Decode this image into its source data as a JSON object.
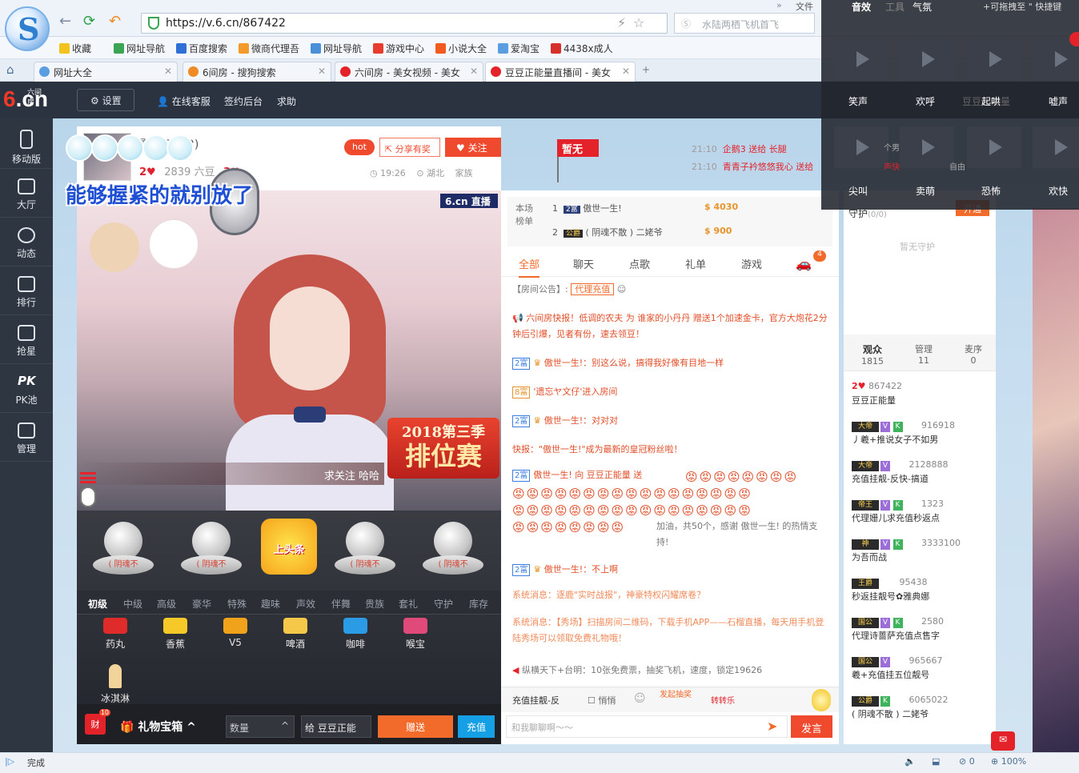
{
  "browser": {
    "url": "https://v.6.cn/867422",
    "search_placeholder": "水陆两栖飞机首飞",
    "menu_more": "文件",
    "bookmarks": [
      "收藏",
      "网址导航",
      "百度搜索",
      "微商代理吾",
      "网址导航",
      "游戏中心",
      "小说大全",
      "爱淘宝",
      "4438x成人"
    ],
    "tabs": [
      {
        "label": "网址大全"
      },
      {
        "label": "6间房 - 搜狗搜索"
      },
      {
        "label": "六间房 - 美女视频 - 美女"
      },
      {
        "label": "豆豆正能量直播间 - 美女"
      }
    ],
    "status": "完成",
    "zoom": "100%",
    "status_count": "0"
  },
  "site": {
    "logo_sub": "六间房",
    "logo_main": ".cn",
    "settings_label": "设置",
    "header_links": [
      "在线客服",
      "签约后台",
      "求助"
    ]
  },
  "leftnav": [
    {
      "label": "移动版",
      "icon": "phone-icon"
    },
    {
      "label": "大厅",
      "icon": "tv-icon"
    },
    {
      "label": "动态",
      "icon": "compass-icon"
    },
    {
      "label": "排行",
      "icon": "crown-icon"
    },
    {
      "label": "抢星",
      "icon": "star-bag-icon"
    },
    {
      "label": "PK池",
      "icon": "pk-icon"
    },
    {
      "label": "管理",
      "icon": "users-icon"
    }
  ],
  "room": {
    "host_name": "量(867422)",
    "hearts_left": "2",
    "six_beans": "2839 六豆",
    "hearts_right": "3",
    "hot": "hot",
    "share": "分享有奖",
    "follow": "关注",
    "time": "19:26",
    "location": "湖北",
    "family": "家族",
    "overlay_text": "能够握紧的就别放了",
    "video_badge": "6.cn 直播",
    "season_year": "2018第三季",
    "season_title": "排位赛",
    "strip_text": "求关注  哈哈"
  },
  "banner": {
    "flag": "暂无",
    "notices": [
      {
        "time": "21:10",
        "text": "企鹅3 送给 长腿"
      },
      {
        "time": "21:10",
        "text": "青青子衿悠悠我心 送给"
      }
    ]
  },
  "gift": {
    "slots": [
      "( 阴魂不",
      "( 阴魂不",
      "上头条",
      "( 阴魂不",
      "( 阴魂不"
    ],
    "tabs": [
      "初级",
      "中级",
      "高级",
      "豪华",
      "特殊",
      "趣味",
      "声效",
      "伴舞",
      "贵族",
      "套礼",
      "守护",
      "库存"
    ],
    "items": [
      {
        "label": "药丸",
        "color": "#e02b2b"
      },
      {
        "label": "香蕉",
        "color": "#f6c928"
      },
      {
        "label": "V5",
        "color": "#f0a21b"
      },
      {
        "label": "啤酒",
        "color": "#f5c84a"
      },
      {
        "label": "咖啡",
        "color": "#2c9be6"
      },
      {
        "label": "喉宝",
        "color": "#e04a7a"
      },
      {
        "label": "冰淇淋",
        "color": "#f2d39a"
      }
    ],
    "cai_badge": "10",
    "cai_label": "财",
    "box_label": "礼物宝箱",
    "qty_label": "数量",
    "to_label": "给 豆豆正能",
    "send": "赠送",
    "recharge": "充值"
  },
  "chat": {
    "rank_title": "本场榜单",
    "ranks": [
      {
        "no": "1",
        "name": "傲世一生!",
        "score": "4030"
      },
      {
        "no": "2",
        "name": "( 阴魂不散 ) 二姥爷",
        "score": "900"
      }
    ],
    "tabs": [
      "全部",
      "聊天",
      "点歌",
      "礼单",
      "游戏"
    ],
    "car_badge": "4",
    "announce_label": "【房间公告】:",
    "announce_link": "代理充值",
    "messages": [
      "六间房快报！低调的农夫 为 谁家的小丹丹 赠送1个加速金卡，官方大炮花2分钟后引爆，见者有份，速去领豆！",
      "傲世一生!：别这么说，搞得我好像有目地一样",
      "'遗忘ヤ文仔'进入房间",
      "傲世一生!：对对对",
      "快报：\"傲世一生!\"成为最新的皇冠粉丝啦！",
      "傲世一生! 向 豆豆正能量 送",
      "加油，共50个，感谢 傲世一生! 的热情支持!",
      "傲世一生!：不上啊",
      "系统消息：逐鹿\"实时战报\"，神豪特权闪耀席卷？",
      "系统消息：【秀场】扫描房间二维码，下载手机APP——石榴直播，每天用手机登陆秀场可以领取免费礼物哦！",
      "纵横天下+台明：10张免费票，抽奖飞机，速度，锁定19626"
    ],
    "input_chip": "充值挂靓-反",
    "private_label": "悄悄",
    "lottery_label": "发起抽奖",
    "wheel_label": "转转乐",
    "input_placeholder": "和我聊聊啊～～",
    "send_label": "发言"
  },
  "right": {
    "guard_label": "守护",
    "guard_count": "(0/0)",
    "guard_btn": "开通",
    "no_guard": "暂无守护",
    "tabs": [
      {
        "label": "观众",
        "count": "1815"
      },
      {
        "label": "管理",
        "count": "11"
      },
      {
        "label": "麦序",
        "count": "0"
      }
    ],
    "users": [
      {
        "level": "2",
        "name": "867422",
        "line2": "豆豆正能量"
      },
      {
        "level": "大帝",
        "name": "916918",
        "line2": "丿羲+推说女子不如男"
      },
      {
        "level": "大帝",
        "name": "2128888",
        "line2": "充值挂靓-反快-搞道"
      },
      {
        "level": "帝王",
        "name": "1323",
        "line2": "代理姗儿求充值秒返点"
      },
      {
        "level": "神",
        "name": "3333100",
        "line2": "为吾而战"
      },
      {
        "level": "王爵",
        "name": "95438",
        "line2": "秒返挂靓号✿雅典娜"
      },
      {
        "level": "国公",
        "name": "2580",
        "line2": "代理诗蔷萨充值点售字"
      },
      {
        "level": "国公",
        "name": "965667",
        "line2": "羲+充值挂五位靓号"
      },
      {
        "level": "公爵",
        "name": "6065022",
        "line2": "( 阴魂不散 ) 二姥爷"
      }
    ]
  },
  "popup": {
    "top_items": [
      "音效",
      "工具",
      "气氛",
      "+可拖拽至 \" 快捷键"
    ],
    "row1": [
      "笑声",
      "欢呼",
      "起哄",
      "嘘声"
    ],
    "row1_hint": "豆豆正能量",
    "row2": [
      "尖叫",
      "卖萌",
      "恐怖",
      "欢快"
    ],
    "row2_hint": [
      "个男",
      "声快",
      "自由"
    ]
  }
}
